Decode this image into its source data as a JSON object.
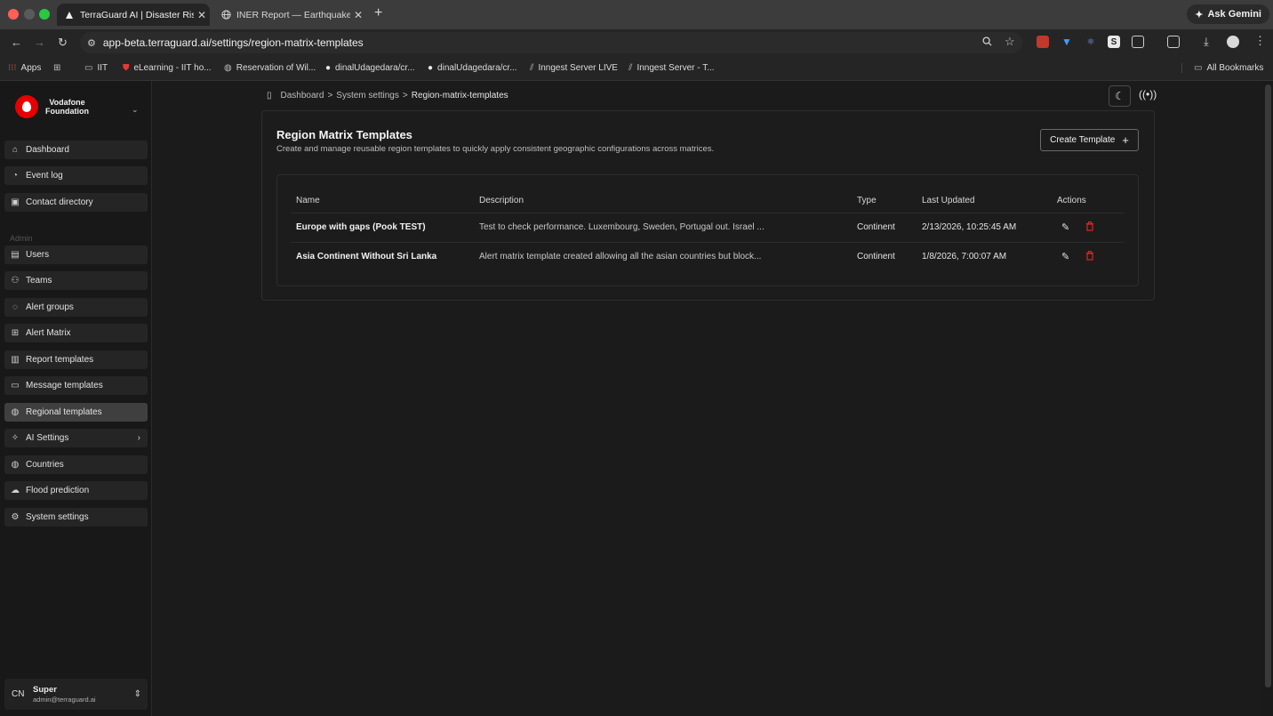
{
  "browser": {
    "tabs": [
      {
        "title": "TerraGuard AI | Disaster Risk",
        "close": "✕",
        "active": true
      },
      {
        "title": "INER Report — Earthquake in",
        "close": "✕",
        "active": false
      }
    ],
    "new_tab": "+",
    "gemini_label": "Ask Gemini",
    "url": "app-beta.terraguard.ai/settings/region-matrix-templates",
    "bookmarks": [
      {
        "label": "Apps",
        "icon": "apps-grid-icon"
      },
      {
        "label": "",
        "icon": "tab-groups-icon"
      },
      {
        "label": "IIT",
        "icon": "folder-icon"
      },
      {
        "label": "eLearning - IIT ho...",
        "icon": "shield-icon"
      },
      {
        "label": "Reservation of Wil...",
        "icon": "globe-icon"
      },
      {
        "label": "dinalUdagedara/cr...",
        "icon": "github-icon"
      },
      {
        "label": "dinalUdagedara/cr...",
        "icon": "github-icon"
      },
      {
        "label": "Inngest Server LIVE",
        "icon": "inngest-icon"
      },
      {
        "label": "Inngest Server - T...",
        "icon": "inngest-icon"
      }
    ],
    "all_bookmarks": "All Bookmarks",
    "colors": {
      "close": "#ff5f57",
      "min": "#5a5a5a",
      "max": "#28c840"
    }
  },
  "sidebar": {
    "org_name_line1": "Vodafone",
    "org_name_line2": "Foundation",
    "brand_color": "#e60000",
    "items_top": [
      {
        "label": "Dashboard",
        "icon": "home-icon"
      },
      {
        "label": "Event log",
        "icon": "event-log-icon"
      },
      {
        "label": "Contact directory",
        "icon": "contact-book-icon"
      }
    ],
    "section_admin": "Admin",
    "items_admin": [
      {
        "label": "Users",
        "icon": "user-badge-icon"
      },
      {
        "label": "Teams",
        "icon": "users-icon"
      },
      {
        "label": "Alert groups",
        "icon": "chat-icon"
      },
      {
        "label": "Alert Matrix",
        "icon": "grid-icon"
      },
      {
        "label": "Report templates",
        "icon": "report-icon"
      },
      {
        "label": "Message templates",
        "icon": "message-icon"
      },
      {
        "label": "Regional templates",
        "icon": "globe-icon",
        "selected": true
      },
      {
        "label": "AI Settings",
        "icon": "sparkles-icon",
        "chevron": "›"
      },
      {
        "label": "Countries",
        "icon": "globe-icon"
      },
      {
        "label": "Flood prediction",
        "icon": "cloud-icon"
      },
      {
        "label": "System settings",
        "icon": "gear-icon"
      }
    ],
    "user": {
      "initials": "CN",
      "name": "Super",
      "email": "admin@terraguard.ai"
    }
  },
  "header": {
    "breadcrumb": [
      "Dashboard",
      "System settings",
      "Region-matrix-templates"
    ],
    "separator": ">"
  },
  "content": {
    "title": "Region Matrix Templates",
    "subtitle": "Create and manage reusable region templates to quickly apply consistent geographic configurations across matrices.",
    "create_label": "Create Template",
    "create_icon": "+",
    "table": {
      "columns": [
        "Name",
        "Description",
        "Type",
        "Last Updated",
        "Actions"
      ],
      "rows": [
        {
          "name": "Europe with gaps (Pook TEST)",
          "description": "Test to check performance. Luxembourg, Sweden, Portugal out. Israel ...",
          "type": "Continent",
          "updated": "2/13/2026, 10:25:45 AM"
        },
        {
          "name": "Asia Continent Without Sri Lanka",
          "description": "Alert matrix template created allowing all the asian countries but block...",
          "type": "Continent",
          "updated": "1/8/2026, 7:00:07 AM"
        }
      ]
    },
    "delete_color": "#e02424"
  }
}
